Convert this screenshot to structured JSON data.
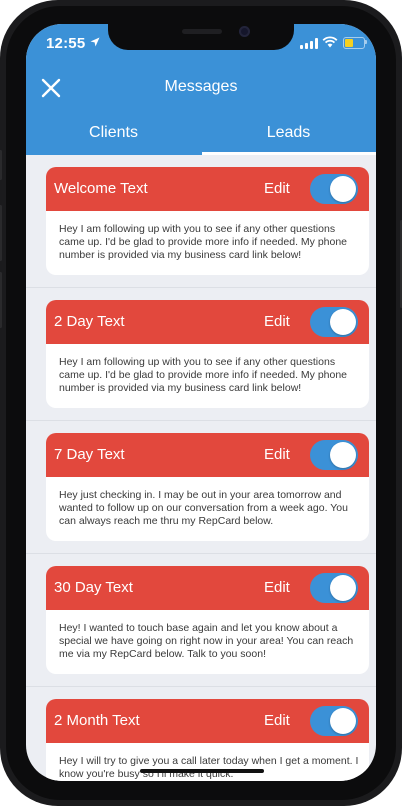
{
  "status_bar": {
    "time": "12:55",
    "battery_level": 0.45,
    "battery_color": "#f5d020",
    "icons": [
      "location-arrow-icon",
      "signal-icon",
      "wifi-icon",
      "battery-icon"
    ]
  },
  "header": {
    "title": "Messages",
    "close_icon": "close-icon",
    "background": "#3b91d7"
  },
  "tabs": [
    {
      "label": "Clients",
      "selected": false
    },
    {
      "label": "Leads",
      "selected": true
    }
  ],
  "messages": [
    {
      "title": "Welcome Text",
      "edit_label": "Edit",
      "enabled": true,
      "body": "Hey I am following up with you to see if any other questions came up. I'd be glad to provide more info if needed. My phone number is provided via my business card link below!"
    },
    {
      "title": "2 Day Text",
      "edit_label": "Edit",
      "enabled": true,
      "body": "Hey I am following up with you to see if any other questions came up. I'd be glad to provide more info if needed. My phone number is provided via my business card link below!"
    },
    {
      "title": "7 Day Text",
      "edit_label": "Edit",
      "enabled": true,
      "body": "Hey just checking in. I may be out in your area tomorrow and wanted to follow up on our conversation from a week ago. You can always reach me thru my RepCard below."
    },
    {
      "title": "30 Day Text",
      "edit_label": "Edit",
      "enabled": true,
      "body": "Hey! I wanted to touch base again and let you know about a special we have going on right now in your area! You can reach me via my RepCard below. Talk to you soon!"
    },
    {
      "title": "2 Month Text",
      "edit_label": "Edit",
      "enabled": true,
      "body": "Hey I will try to give you a call later today when I get a moment. I know you're busy so I'll make it quick."
    }
  ],
  "colors": {
    "card_header": "#e2483d",
    "toggle_on": "#3b91d7",
    "background": "#eceef3"
  }
}
